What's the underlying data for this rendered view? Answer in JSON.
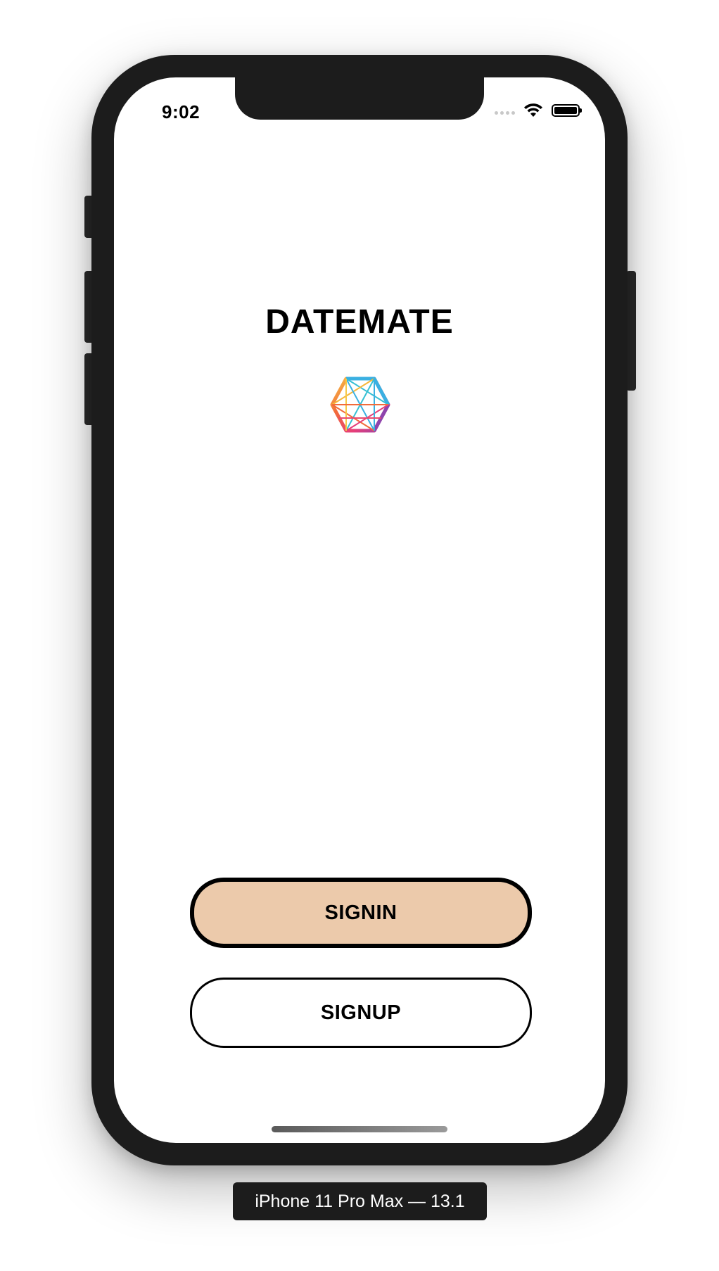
{
  "status_bar": {
    "time": "9:02",
    "icons": [
      "signal-icon",
      "wifi-icon",
      "battery-icon"
    ]
  },
  "app": {
    "title": "DATEMATE",
    "logo_icon": "hexagon-network-logo-icon"
  },
  "actions": {
    "signin_label": "SIGNIN",
    "signup_label": "SIGNUP"
  },
  "device": {
    "label": "iPhone 11 Pro Max — 13.1"
  },
  "colors": {
    "signin_background": "#eccaab",
    "device_frame": "#1c1c1c",
    "text": "#000000"
  }
}
